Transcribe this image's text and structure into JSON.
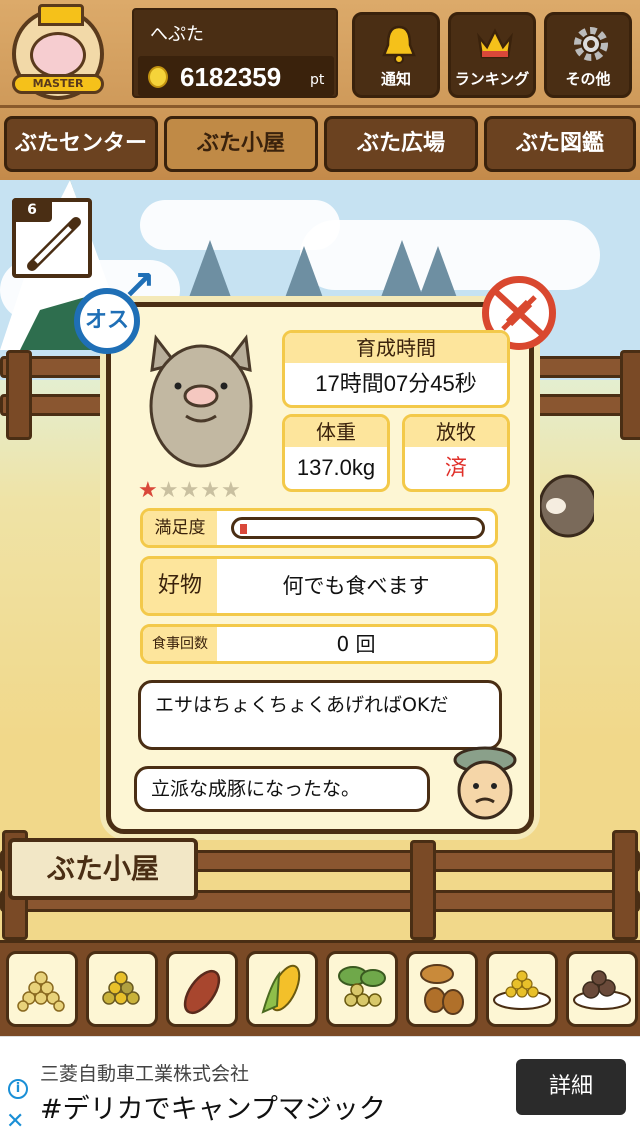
{
  "header": {
    "badge_label": "MASTER",
    "username": "へぷた",
    "points": "6182359",
    "points_unit": "pt",
    "buttons": [
      {
        "label": "通知",
        "icon": "bell-icon"
      },
      {
        "label": "ランキング",
        "icon": "crown-icon"
      },
      {
        "label": "その他",
        "icon": "gear-icon"
      }
    ]
  },
  "tabs": [
    {
      "label": "ぶたセンター",
      "active": false
    },
    {
      "label": "ぶた小屋",
      "active": true
    },
    {
      "label": "ぶた広場",
      "active": false
    },
    {
      "label": "ぶた図鑑",
      "active": false
    }
  ],
  "vaccine": {
    "count": "6"
  },
  "pig": {
    "gender_label": "オス",
    "rating": 1,
    "rating_max": 5,
    "growth_time_label": "育成時間",
    "growth_time_value": "17時間07分45秒",
    "weight_label": "体重",
    "weight_value": "137.0kg",
    "grazing_label": "放牧",
    "grazing_value": "済",
    "satisfaction_label": "満足度",
    "satisfaction_level": 0.03,
    "favorite_label": "好物",
    "favorite_value": "何でも食べます",
    "meals_label": "食事回数",
    "meals_value": "0 回"
  },
  "dialogue": {
    "line1": "エサはちょくちょくあげればOKだ",
    "line2": "立派な成豚になったな。"
  },
  "sign": {
    "label": "ぶた小屋"
  },
  "food_items": [
    "soybeans-icon",
    "mixed-grain-icon",
    "sweet-potato-icon",
    "corn-icon",
    "acorn-leaf-icon",
    "acorns-icon",
    "grain-plate-icon",
    "meatball-plate-icon"
  ],
  "ad": {
    "company": "三菱自動車工業株式会社",
    "title": "#デリカでキャンプマジック",
    "button": "詳細"
  },
  "colors": {
    "male": "#1f6fb6",
    "no_vaccine": "#d9482f",
    "grazing_done": "#e0302a"
  }
}
